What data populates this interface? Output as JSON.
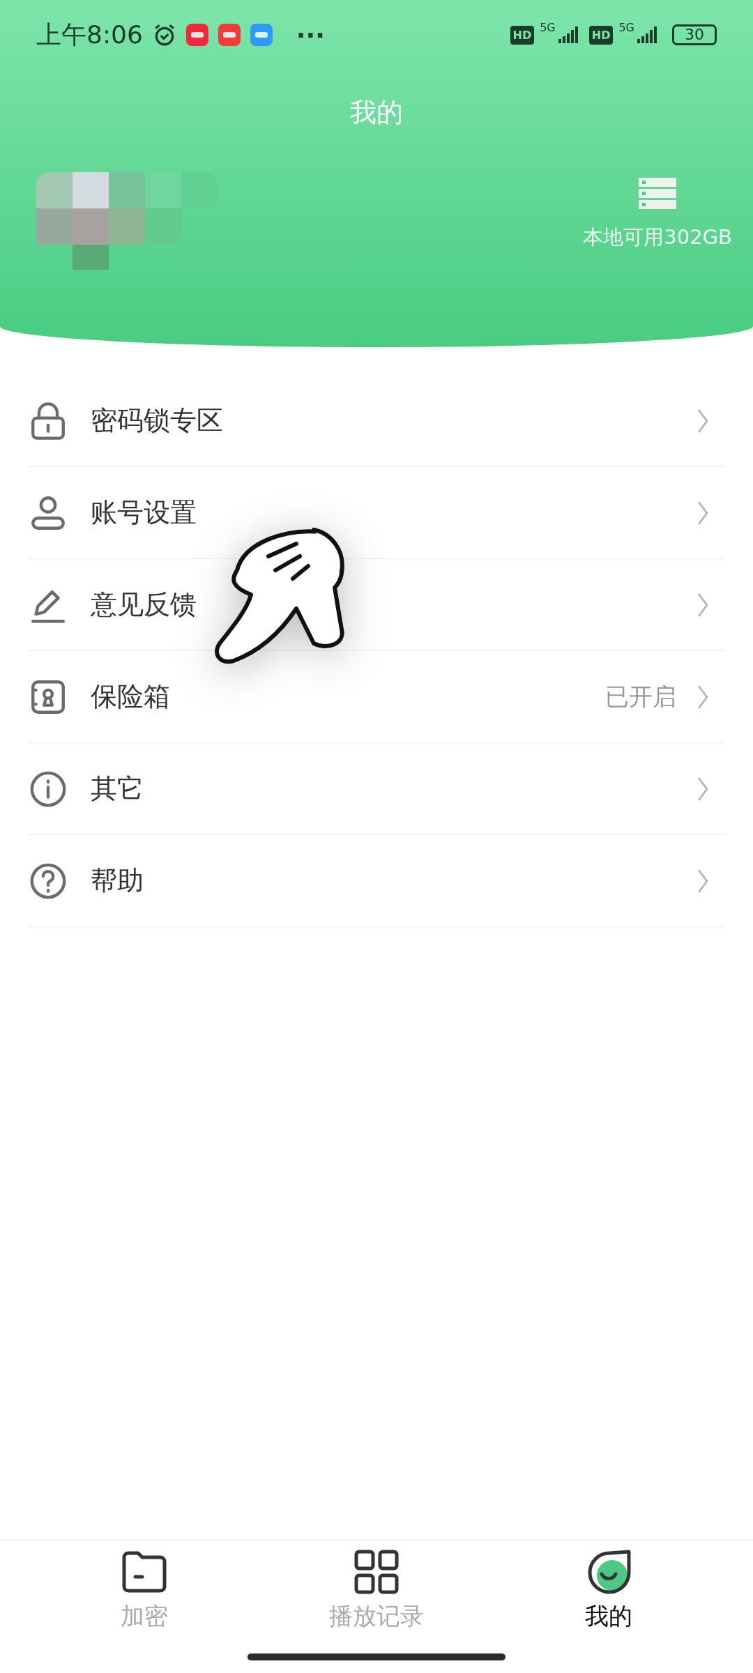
{
  "status_bar": {
    "time": "上午8:06",
    "more": "···",
    "sims": [
      {
        "badge": "HD",
        "network": "5G"
      },
      {
        "badge": "HD",
        "network": "5G"
      }
    ],
    "battery": "30"
  },
  "header": {
    "title": "我的",
    "storage": "本地可用302GB"
  },
  "menu": [
    {
      "label": "密码锁专区"
    },
    {
      "label": "账号设置"
    },
    {
      "label": "意见反馈"
    },
    {
      "label": "保险箱",
      "value": "已开启"
    },
    {
      "label": "其它"
    },
    {
      "label": "帮助"
    }
  ],
  "tabs": [
    {
      "label": "加密",
      "selected": false
    },
    {
      "label": "播放记录",
      "selected": false
    },
    {
      "label": "我的",
      "selected": true
    }
  ]
}
